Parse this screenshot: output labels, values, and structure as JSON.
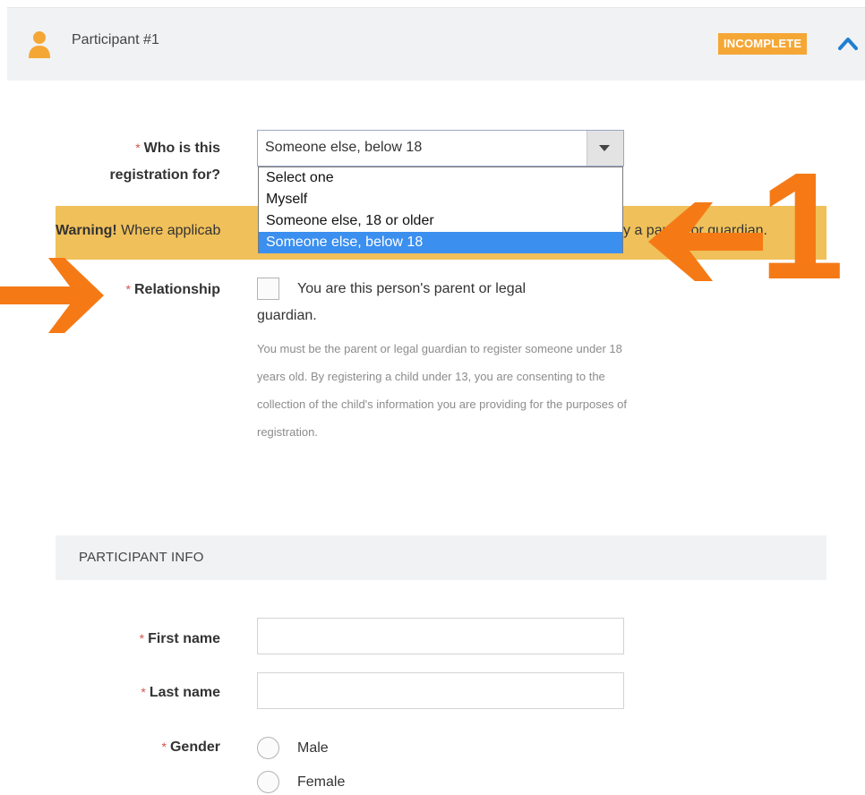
{
  "header": {
    "title": "Participant #1",
    "status_badge": "INCOMPLETE",
    "icon": "person-icon",
    "collapse_icon": "chevron-up-icon"
  },
  "registration": {
    "label": "Who is this registration for?",
    "label_line1": "Who is this",
    "label_line2": "registration for?",
    "selected_value": "Someone else, below 18",
    "options": [
      "Select one",
      "Myself",
      "Someone else, 18 or older",
      "Someone else, below 18"
    ]
  },
  "warning": {
    "strong": "Warning!",
    "text_start": " Where applicab",
    "text_end": "y a parent or guardian."
  },
  "relationship": {
    "label": "Relationship",
    "checkbox_line1": "You are this person's parent or legal",
    "checkbox_line2": "guardian.",
    "help_text": "You must be the parent or legal guardian to register someone under 18 years old. By registering a child under 13, you are consenting to the collection of the child's information you are providing for the purposes of registration."
  },
  "participant_info": {
    "section_title": "PARTICIPANT INFO",
    "first_name_label": "First name",
    "last_name_label": "Last name",
    "gender_label": "Gender",
    "gender_options": [
      "Male",
      "Female"
    ]
  },
  "annotations": {
    "number": "1"
  },
  "colors": {
    "badge": "#f5a735",
    "warning_bg": "#f0c05a",
    "annotation": "#f57a16",
    "selected_option": "#3b8fef",
    "chevron": "#1f7fd1"
  }
}
